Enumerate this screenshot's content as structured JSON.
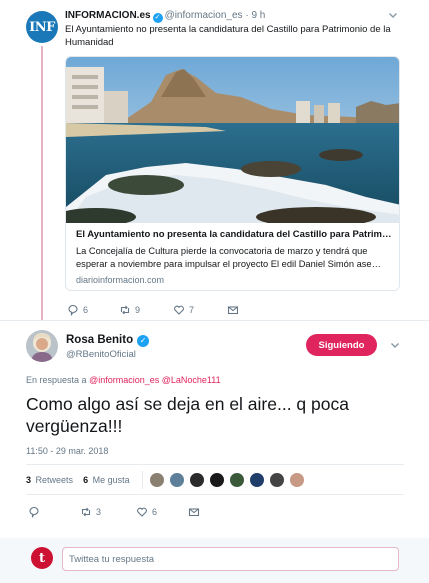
{
  "parent_tweet": {
    "avatar_text": "INF",
    "author_name": "INFORMACION.es",
    "author_handle": "@informacion_es",
    "separator": "·",
    "time_ago": "9 h",
    "text": "El Ayuntamiento no presenta la candidatura del Castillo para Patrimonio de la Humanidad",
    "card": {
      "title": "El Ayuntamiento no presenta la candidatura del Castillo para Patrim…",
      "description": "La Concejalía de Cultura pierde la convocatoria de marzo y tendrá que esperar a noviembre para impulsar el proyecto El edil Daniel Simón ase…",
      "domain": "diarioinformacion.com"
    },
    "actions": {
      "replies": "6",
      "retweets": "9",
      "likes": "7"
    }
  },
  "main_tweet": {
    "author_name": "Rosa Benito",
    "author_handle": "@RBenitoOficial",
    "follow_label": "Siguiendo",
    "reply_prefix": "En respuesta a",
    "reply_mention_1": "@informacion_es",
    "reply_mention_2": "@LaNoche111",
    "text": "Como algo así se deja en el aire... q poca vergüenza!!!",
    "timestamp": "11:50 - 29 mar. 2018",
    "stats": {
      "retweets_count": "3",
      "retweets_label": "Retweets",
      "likes_count": "6",
      "likes_label": "Me gusta"
    },
    "actions": {
      "retweets": "3",
      "likes": "6"
    }
  },
  "reply_box": {
    "avatar_text": "t",
    "placeholder": "Twittea tu respuesta"
  },
  "colors": {
    "accent": "#e0245e",
    "verified": "#1da1f2",
    "muted": "#657786",
    "border": "#e6ecf0"
  }
}
